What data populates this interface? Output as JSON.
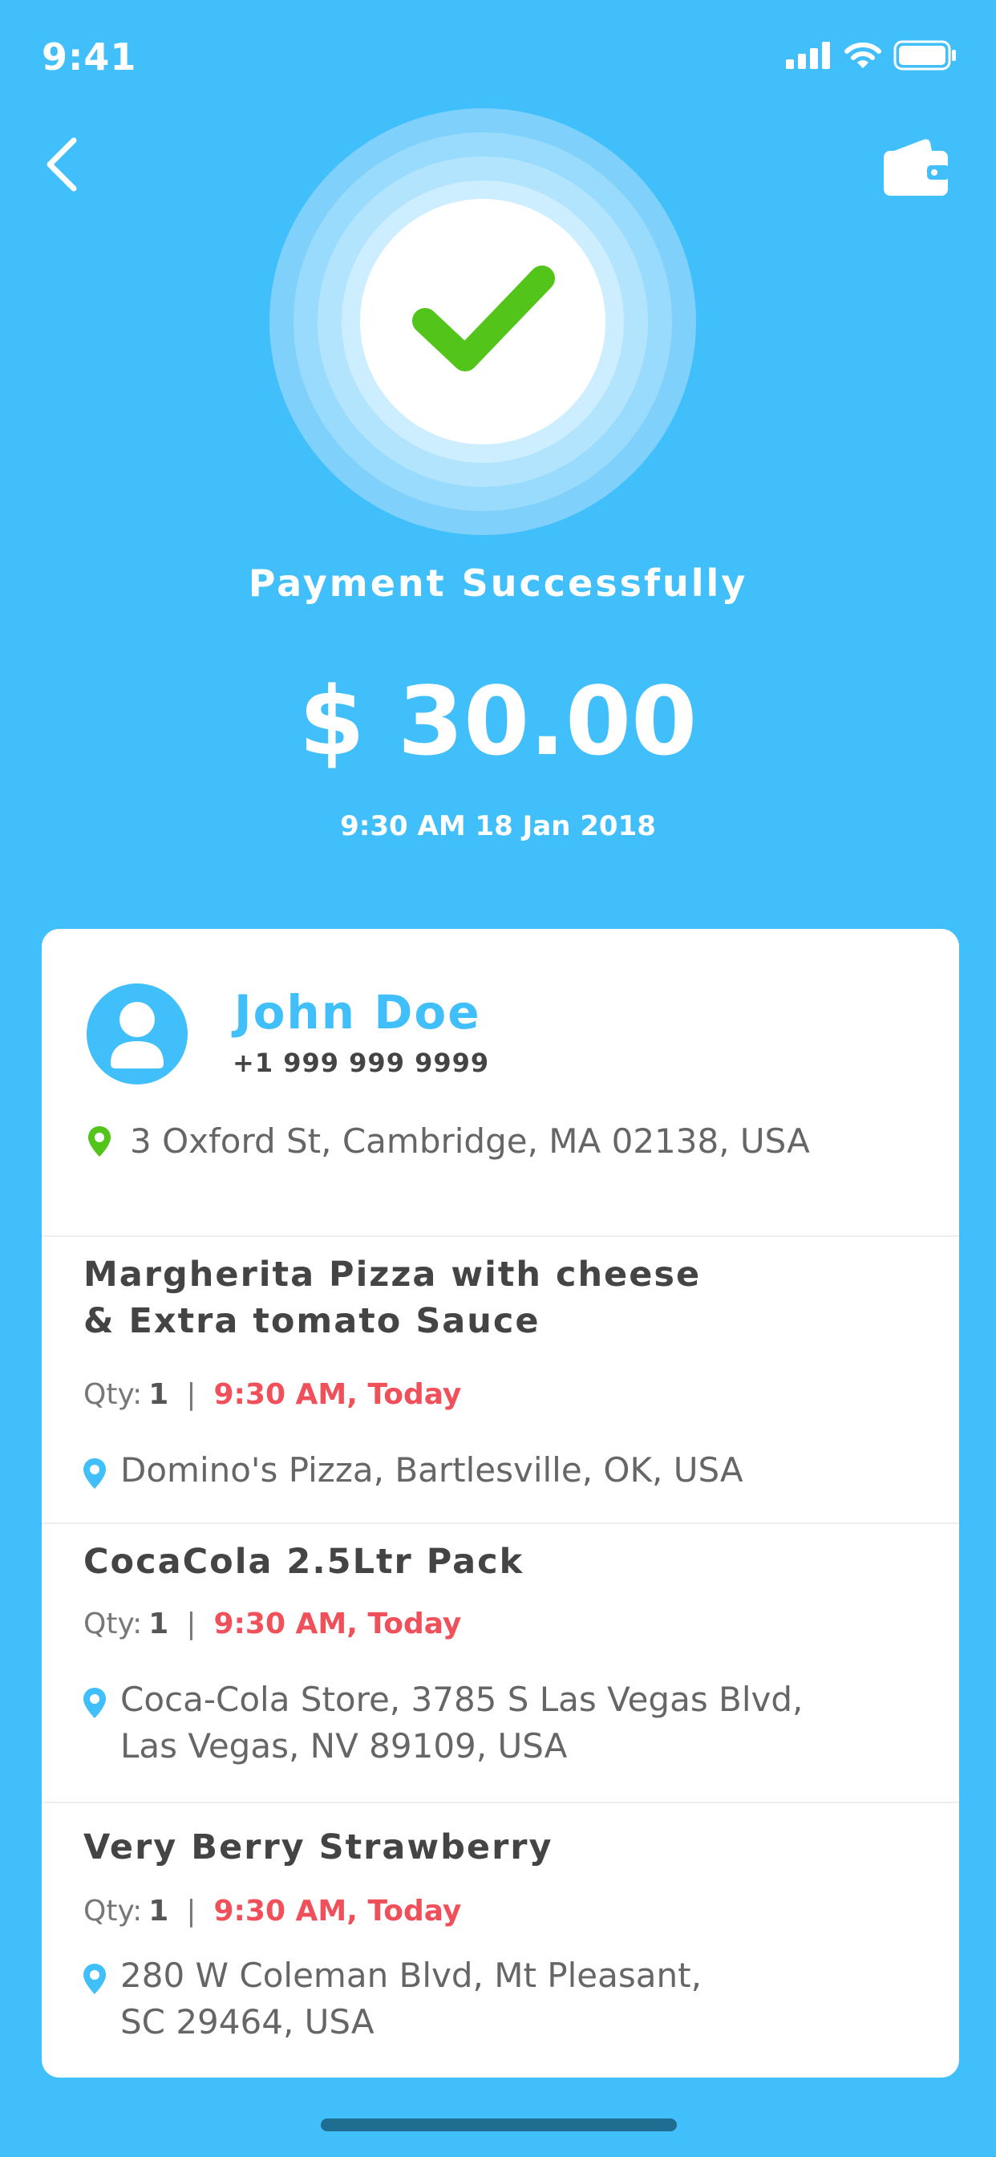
{
  "status_bar": {
    "time": "9:41"
  },
  "header": {
    "back_icon": "chevron-left-icon",
    "wallet_icon": "wallet-icon"
  },
  "payment": {
    "status_icon": "check-icon",
    "title": "Payment  Successfully",
    "amount": "$ 30.00",
    "datetime": "9:30 AM 18 Jan 2018"
  },
  "customer": {
    "name": "John Doe",
    "phone": "+1 999 999 9999",
    "address": "3 Oxford St, Cambridge, MA 02138, USA"
  },
  "items": [
    {
      "title_line1": "Margherita Pizza with cheese",
      "title_line2": "& Extra tomato Sauce",
      "qty_label": "Qty:",
      "qty": "1",
      "separator": "|",
      "time": "9:30 AM, Today",
      "location_line1": "Domino's Pizza, Bartlesville, OK, USA",
      "location_line2": ""
    },
    {
      "title_line1": "CocaCola 2.5Ltr Pack",
      "title_line2": "",
      "qty_label": "Qty:",
      "qty": "1",
      "separator": "|",
      "time": "9:30 AM, Today",
      "location_line1": "Coca-Cola Store,  3785 S Las Vegas Blvd,",
      "location_line2": "Las Vegas, NV 89109, USA"
    },
    {
      "title_line1": "Very Berry Strawberry",
      "title_line2": "",
      "qty_label": "Qty:",
      "qty": "1",
      "separator": "|",
      "time": "9:30 AM, Today",
      "location_line1": "280 W Coleman Blvd, Mt Pleasant,",
      "location_line2": "SC 29464, USA"
    }
  ],
  "colors": {
    "background": "#41bffa",
    "accent": "#41bffa",
    "success": "#52c41a",
    "time_red": "#f0505a"
  }
}
